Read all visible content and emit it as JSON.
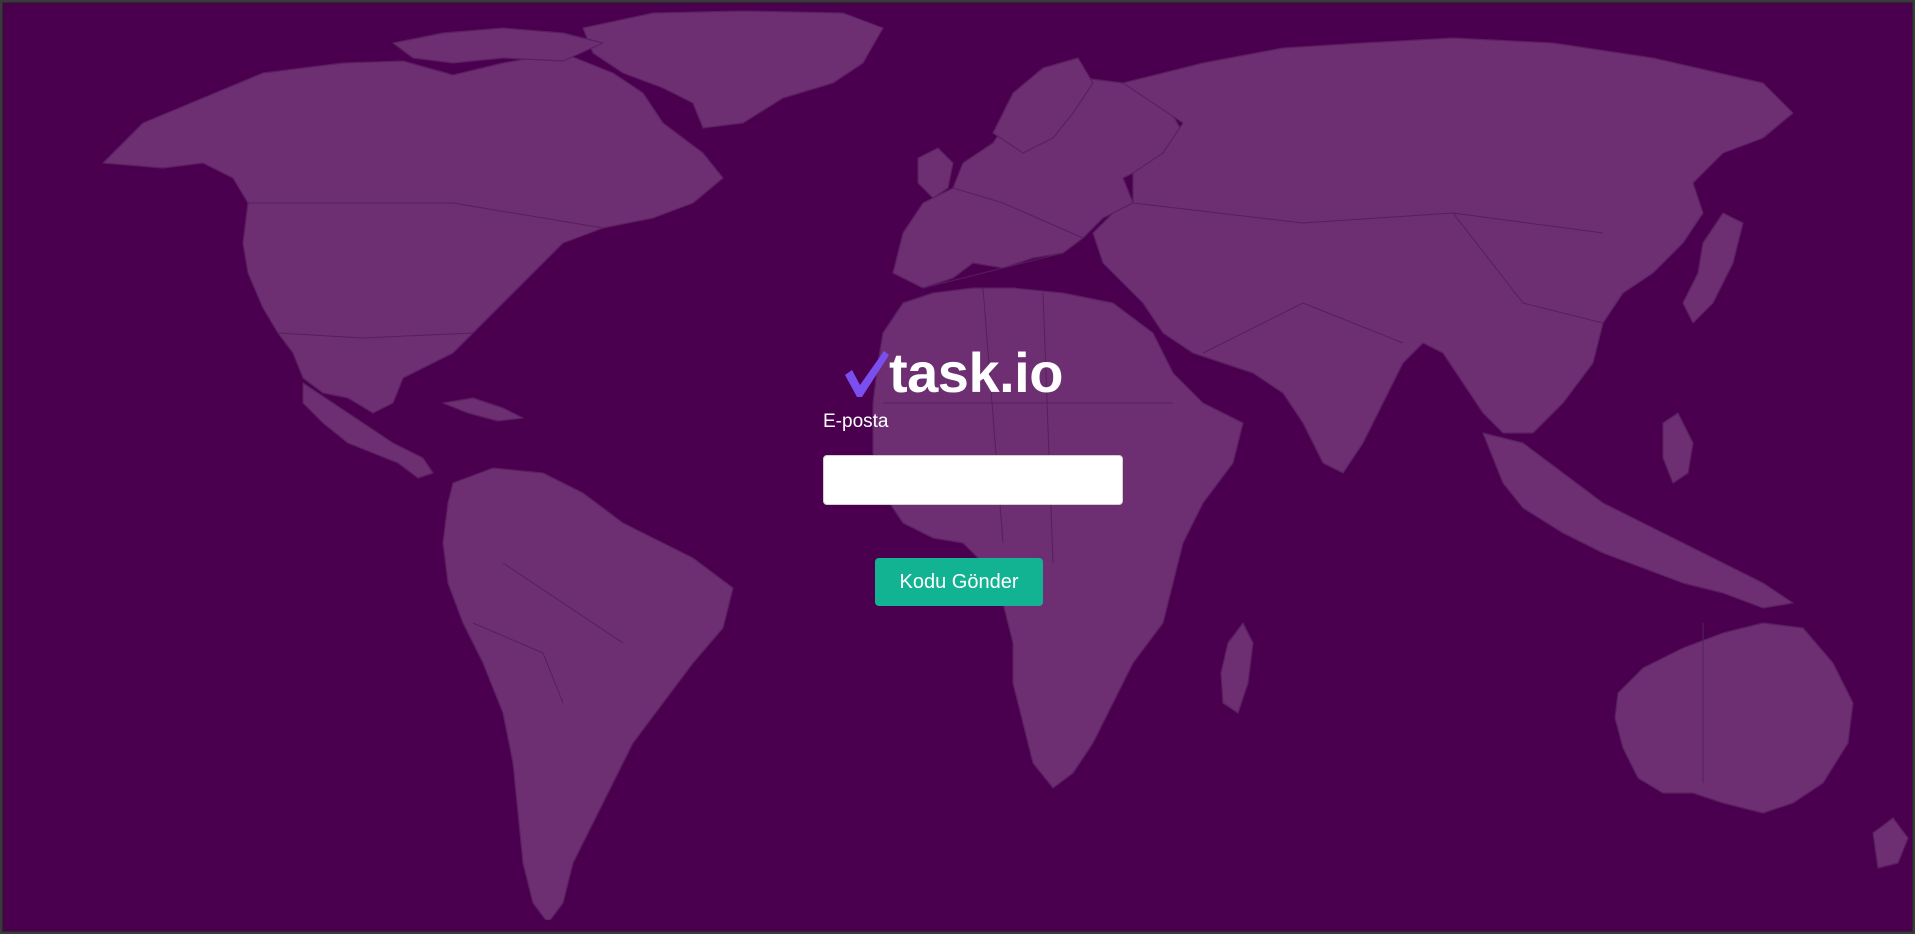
{
  "brand": {
    "name": "task.io",
    "logo_icon": "checkmark-icon",
    "accent_color": "#7b4ef0"
  },
  "form": {
    "email_label": "E-posta",
    "email_value": "",
    "email_placeholder": "",
    "submit_label": "Kodu Gönder"
  },
  "theme": {
    "background": "#4a004f",
    "land": "#6d2f72",
    "button": "#12b393"
  },
  "background_image": "world-map"
}
